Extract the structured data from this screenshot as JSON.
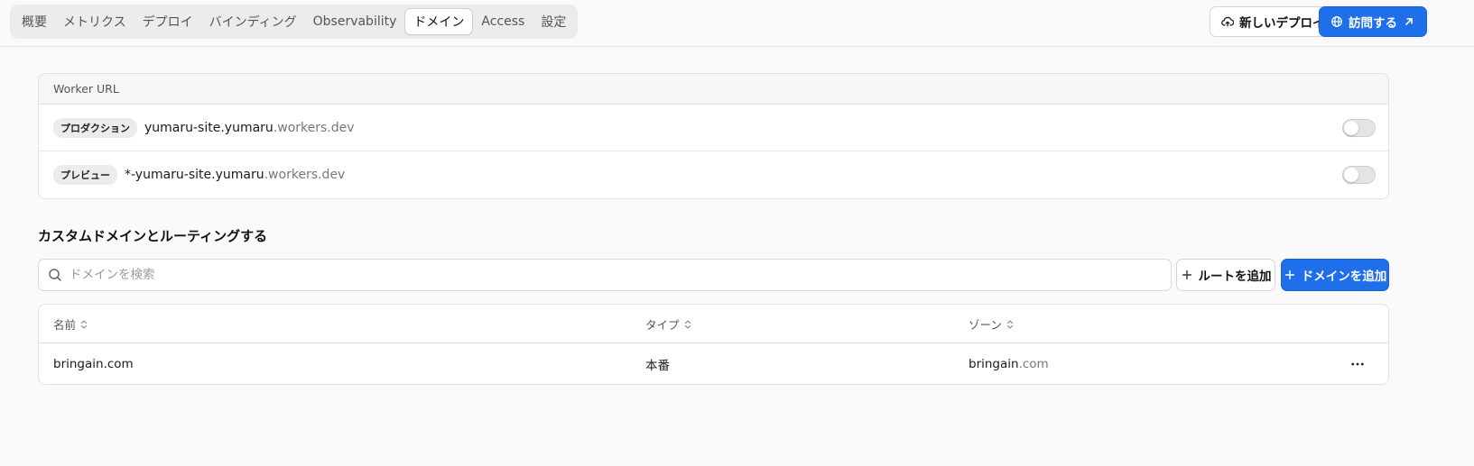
{
  "tabs": [
    {
      "label": "概要",
      "active": false
    },
    {
      "label": "メトリクス",
      "active": false
    },
    {
      "label": "デプロイ",
      "active": false
    },
    {
      "label": "バインディング",
      "active": false
    },
    {
      "label": "Observability",
      "active": false
    },
    {
      "label": "ドメイン",
      "active": true
    },
    {
      "label": "Access",
      "active": false
    },
    {
      "label": "設定",
      "active": false
    }
  ],
  "header": {
    "new_deploy_label": "新しいデプロイ",
    "visit_label": "訪問する"
  },
  "worker_url": {
    "title": "Worker URL",
    "rows": [
      {
        "badge": "プロダクション",
        "host": "yumaru-site.yumaru",
        "suffix": ".workers.dev",
        "enabled": false
      },
      {
        "badge": "プレビュー",
        "host": "*-yumaru-site.yumaru",
        "suffix": ".workers.dev",
        "enabled": false
      }
    ]
  },
  "custom_domains": {
    "title": "カスタムドメインとルーティングする",
    "search_placeholder": "ドメインを検索",
    "add_route_label": "ルートを追加",
    "add_domain_label": "ドメインを追加",
    "columns": [
      "名前",
      "タイプ",
      "ゾーン"
    ],
    "rows": [
      {
        "name": "bringain.com",
        "type": "本番",
        "zone_main": "bringain",
        "zone_suffix": ".com"
      }
    ]
  },
  "colors": {
    "accent": "#1f6feb",
    "background": "#fafafa",
    "muted_text": "#777777"
  }
}
